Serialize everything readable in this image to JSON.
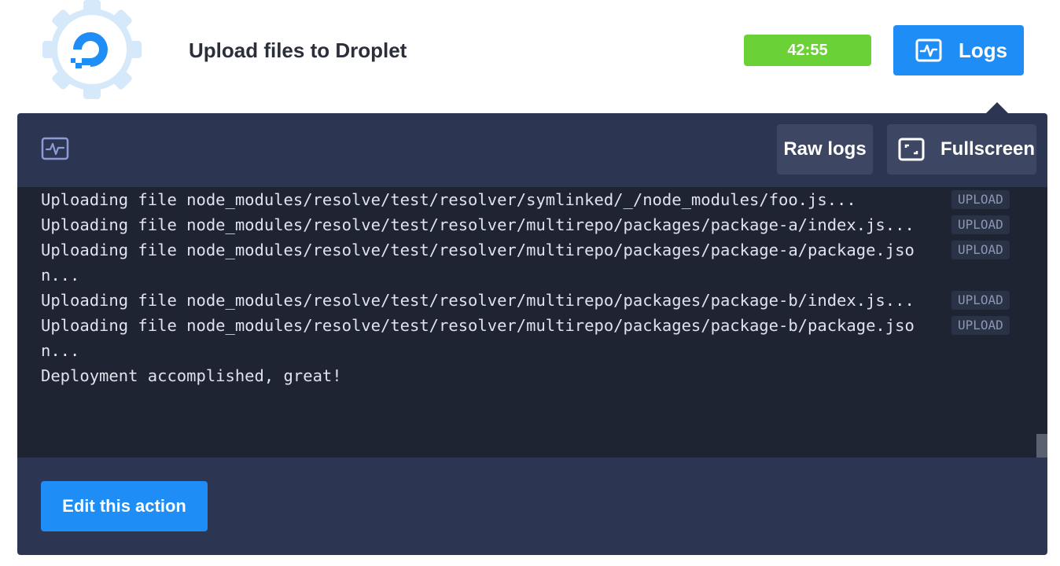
{
  "header": {
    "title": "Upload files to Droplet",
    "timer": "42:55",
    "logs_label": "Logs"
  },
  "toolbar": {
    "raw_logs_label": "Raw logs",
    "fullscreen_label": "Fullscreen"
  },
  "log": {
    "lines": [
      {
        "text": "Uploading file node_modules/resolve/test/resolver/symlinked/_/node_modules/foo.js...",
        "tag": "UPLOAD"
      },
      {
        "text": "Uploading file node_modules/resolve/test/resolver/multirepo/packages/package-a/index.js...",
        "tag": "UPLOAD"
      },
      {
        "text": "Uploading file node_modules/resolve/test/resolver/multirepo/packages/package-a/package.json...",
        "tag": "UPLOAD"
      },
      {
        "text": "Uploading file node_modules/resolve/test/resolver/multirepo/packages/package-b/index.js...",
        "tag": "UPLOAD"
      },
      {
        "text": "Uploading file node_modules/resolve/test/resolver/multirepo/packages/package-b/package.json...",
        "tag": "UPLOAD"
      },
      {
        "text": "Deployment accomplished, great!",
        "tag": ""
      }
    ]
  },
  "footer": {
    "edit_label": "Edit this action"
  },
  "icons": {
    "app": "digitalocean-gear-icon",
    "logs": "activity-monitor-icon",
    "fullscreen": "fullscreen-icon"
  },
  "colors": {
    "accent": "#1e8df5",
    "timer": "#6ad136",
    "panel": "#2c3652",
    "log_bg": "#1f2433"
  }
}
